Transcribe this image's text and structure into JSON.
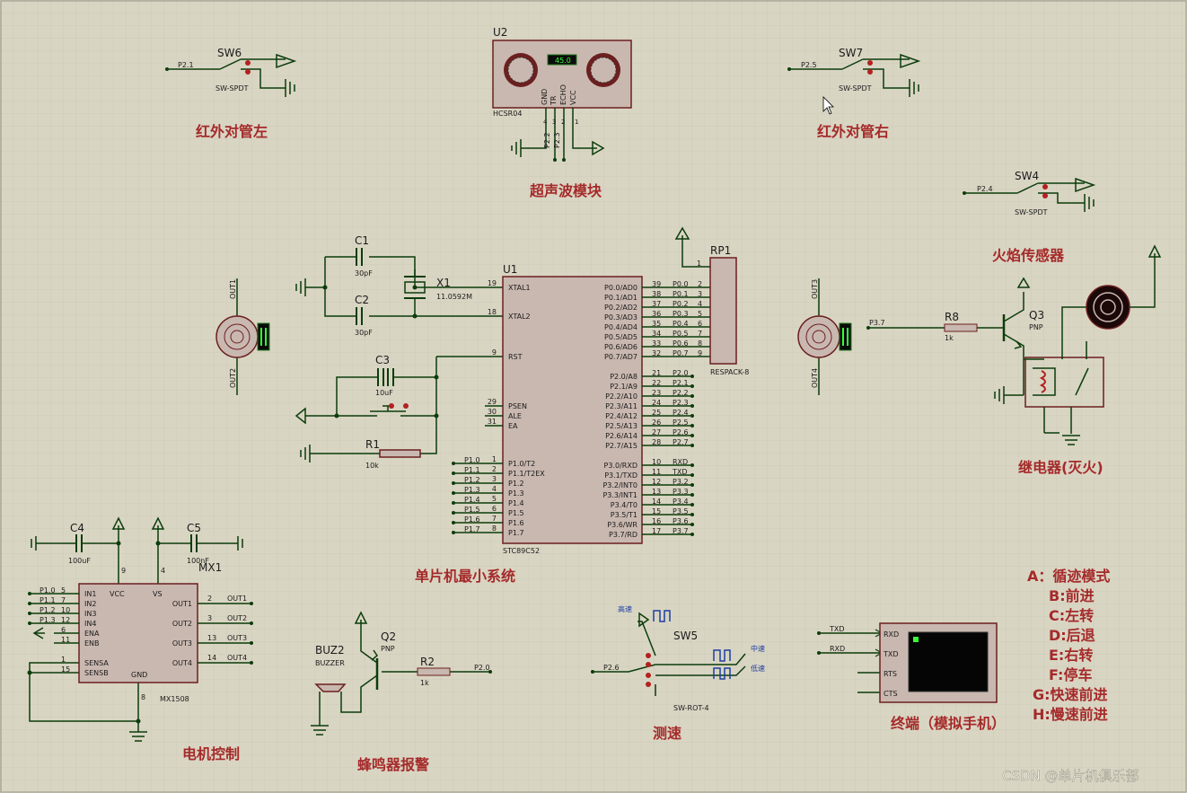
{
  "colors": {
    "background": "#d9d5c3",
    "grid": "#c6c2b0",
    "wire": "#0b3d0b",
    "chip_fill": "#c9b8b0",
    "chip_stroke": "#6b1f1f",
    "heading": "#a52a2a",
    "pin": "#1b1b1b"
  },
  "headings": {
    "ir_left": "红外对管左",
    "ir_right": "红外对管右",
    "ultrasonic": "超声波模块",
    "flame": "火焰传感器",
    "relay": "继电器(灭火)",
    "mcu_system": "单片机最小系统",
    "motor": "电机控制",
    "buzzer": "蜂鸣器报警",
    "speed": "测速",
    "terminal": "终端（模拟手机）"
  },
  "mode_list": [
    "A：循迹模式",
    "B:前进",
    "C:左转",
    "D:后退",
    "E:右转",
    "F:停车",
    "G:快速前进",
    "H:慢速前进"
  ],
  "watermark": "CSDN @单片机俱乐部",
  "switches": {
    "sw6": {
      "ref": "SW6",
      "type": "SW-SPDT",
      "net": "P2.1"
    },
    "sw7": {
      "ref": "SW7",
      "type": "SW-SPDT",
      "net": "P2.5"
    },
    "sw4": {
      "ref": "SW4",
      "type": "SW-SPDT",
      "net": "P2.4"
    },
    "sw5": {
      "ref": "SW5",
      "type": "SW-ROT-4",
      "net": "P2.6",
      "pos1": "高速",
      "pos2": "中速",
      "pos3": "低速"
    }
  },
  "ultrasonic": {
    "ref": "U2",
    "part": "HCSR04",
    "display": "45.0",
    "pins": [
      "GND",
      "TR",
      "ECHO",
      "VCC"
    ],
    "pin_nums": [
      "4",
      "3",
      "2",
      "1"
    ],
    "nets": [
      "P2.2",
      "P2.3"
    ]
  },
  "mcu": {
    "ref": "U1",
    "part": "STC89C52",
    "left_pins": [
      {
        "num": "19",
        "name": "XTAL1"
      },
      {
        "num": "18",
        "name": "XTAL2"
      },
      {
        "num": "9",
        "name": "RST"
      },
      {
        "num": "29",
        "name": "PSEN"
      },
      {
        "num": "30",
        "name": "ALE"
      },
      {
        "num": "31",
        "name": "EA"
      },
      {
        "num": "1",
        "name": "P1.0/T2"
      },
      {
        "num": "2",
        "name": "P1.1/T2EX"
      },
      {
        "num": "3",
        "name": "P1.2"
      },
      {
        "num": "4",
        "name": "P1.3"
      },
      {
        "num": "5",
        "name": "P1.4"
      },
      {
        "num": "6",
        "name": "P1.5"
      },
      {
        "num": "7",
        "name": "P1.6"
      },
      {
        "num": "8",
        "name": "P1.7"
      }
    ],
    "p1_nets": [
      "P1.0",
      "P1.1",
      "P1.2",
      "P1.3",
      "P1.4",
      "P1.5",
      "P1.6",
      "P1.7"
    ],
    "right_pins": [
      {
        "num": "39",
        "name": "P0.0/AD0",
        "net": "P0.0"
      },
      {
        "num": "38",
        "name": "P0.1/AD1",
        "net": "P0.1"
      },
      {
        "num": "37",
        "name": "P0.2/AD2",
        "net": "P0.2"
      },
      {
        "num": "36",
        "name": "P0.3/AD3",
        "net": "P0.3"
      },
      {
        "num": "35",
        "name": "P0.4/AD4",
        "net": "P0.4"
      },
      {
        "num": "34",
        "name": "P0.5/AD5",
        "net": "P0.5"
      },
      {
        "num": "33",
        "name": "P0.6/AD6",
        "net": "P0.6"
      },
      {
        "num": "32",
        "name": "P0.7/AD7",
        "net": "P0.7"
      },
      {
        "num": "21",
        "name": "P2.0/A8",
        "net": "P2.0"
      },
      {
        "num": "22",
        "name": "P2.1/A9",
        "net": "P2.1"
      },
      {
        "num": "23",
        "name": "P2.2/A10",
        "net": "P2.2"
      },
      {
        "num": "24",
        "name": "P2.3/A11",
        "net": "P2.3"
      },
      {
        "num": "25",
        "name": "P2.4/A12",
        "net": "P2.4"
      },
      {
        "num": "26",
        "name": "P2.5/A13",
        "net": "P2.5"
      },
      {
        "num": "27",
        "name": "P2.6/A14",
        "net": "P2.6"
      },
      {
        "num": "28",
        "name": "P2.7/A15",
        "net": "P2.7"
      },
      {
        "num": "10",
        "name": "P3.0/RXD",
        "net": "RXD"
      },
      {
        "num": "11",
        "name": "P3.1/TXD",
        "net": "TXD"
      },
      {
        "num": "12",
        "name": "P3.2/INT0",
        "net": "P3.2"
      },
      {
        "num": "13",
        "name": "P3.3/INT1",
        "net": "P3.3"
      },
      {
        "num": "14",
        "name": "P3.4/T0",
        "net": "P3.4"
      },
      {
        "num": "15",
        "name": "P3.5/T1",
        "net": "P3.5"
      },
      {
        "num": "16",
        "name": "P3.6/WR",
        "net": "P3.6"
      },
      {
        "num": "17",
        "name": "P3.7/RD",
        "net": "P3.7"
      }
    ]
  },
  "crystal": {
    "ref": "X1",
    "value": "11.0592M"
  },
  "caps": {
    "c1": {
      "ref": "C1",
      "value": "30pF"
    },
    "c2": {
      "ref": "C2",
      "value": "30pF"
    },
    "c3": {
      "ref": "C3",
      "value": "10uF"
    },
    "c4": {
      "ref": "C4",
      "value": "100uF"
    },
    "c5": {
      "ref": "C5",
      "value": "100nF"
    }
  },
  "resistors": {
    "r1": {
      "ref": "R1",
      "value": "10k"
    },
    "r2": {
      "ref": "R2",
      "value": "1k"
    },
    "r8": {
      "ref": "R8",
      "value": "1k"
    }
  },
  "respack": {
    "ref": "RP1",
    "part": "RESPACK-8",
    "pin1": "1",
    "pins": [
      "2",
      "3",
      "4",
      "5",
      "6",
      "7",
      "8",
      "9"
    ]
  },
  "motor_left": {
    "top": "OUT1",
    "bottom": "OUT2"
  },
  "motor_right": {
    "top": "OUT3",
    "bottom": "OUT4"
  },
  "driver": {
    "ref": "MX1",
    "part": "MX1508",
    "vcc": "VCC",
    "vs": "VS",
    "gnd": "GND",
    "vcc_pin": "9",
    "vs_pin": "4",
    "gnd_pin": "8",
    "inputs": [
      {
        "name": "IN1",
        "num": "5",
        "net": "P1.0"
      },
      {
        "name": "IN2",
        "num": "7",
        "net": "P1.1"
      },
      {
        "name": "IN3",
        "num": "10",
        "net": "P1.2"
      },
      {
        "name": "IN4",
        "num": "12",
        "net": "P1.3"
      },
      {
        "name": "ENA",
        "num": "6",
        "net": ""
      },
      {
        "name": "ENB",
        "num": "11",
        "net": ""
      }
    ],
    "sense": [
      {
        "name": "SENSA",
        "num": "1"
      },
      {
        "name": "SENSB",
        "num": "15"
      }
    ],
    "outputs": [
      {
        "name": "OUT1",
        "num": "2",
        "net": "OUT1"
      },
      {
        "name": "OUT2",
        "num": "3",
        "net": "OUT2"
      },
      {
        "name": "OUT3",
        "num": "13",
        "net": "OUT3"
      },
      {
        "name": "OUT4",
        "num": "14",
        "net": "OUT4"
      }
    ]
  },
  "buzzer": {
    "ref": "BUZ2",
    "part": "BUZZER",
    "net": "P2.0"
  },
  "transistors": {
    "q2": {
      "ref": "Q2",
      "type": "PNP"
    },
    "q3": {
      "ref": "Q3",
      "type": "PNP"
    }
  },
  "relay_net": "P3.7",
  "terminal": {
    "pins": [
      "RXD",
      "TXD",
      "RTS",
      "CTS"
    ],
    "nets": [
      "TXD",
      "RXD"
    ]
  }
}
